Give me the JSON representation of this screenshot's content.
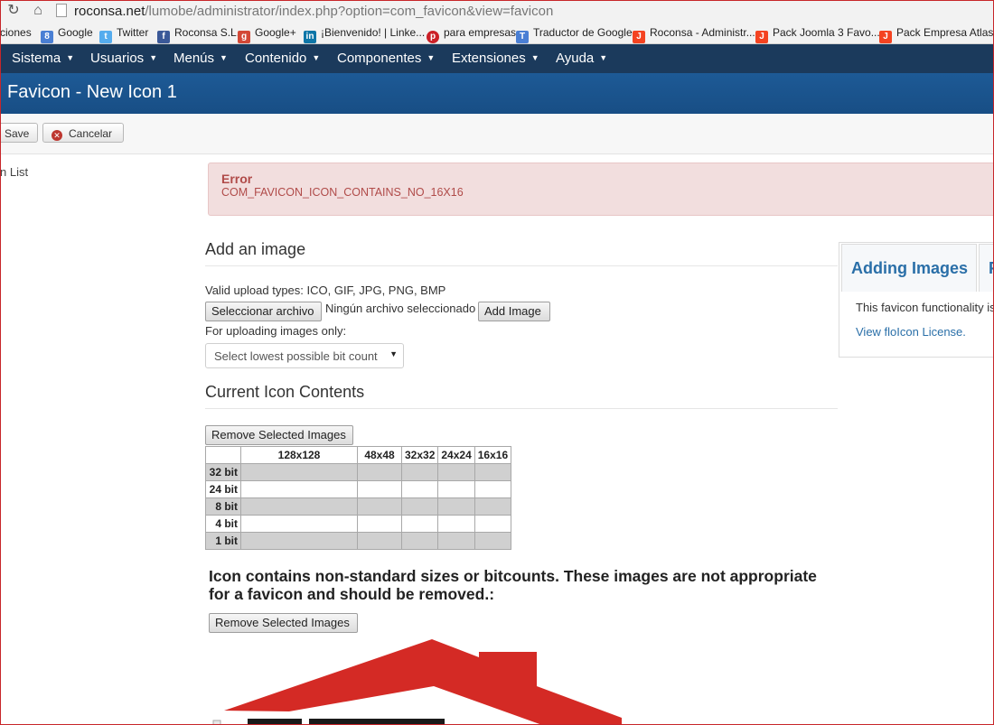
{
  "browser": {
    "url_host": "roconsa.net",
    "url_path": "/lumobe/administrator/index.php?option=com_favicon&view=favicon"
  },
  "bookmarks": [
    {
      "label": "ciones"
    },
    {
      "label": "Google"
    },
    {
      "label": "Twitter"
    },
    {
      "label": "Roconsa S.L."
    },
    {
      "label": "Google+"
    },
    {
      "label": "¡Bienvenido! | Linke..."
    },
    {
      "label": "para empresas"
    },
    {
      "label": "Traductor de Google"
    },
    {
      "label": "Roconsa - Administr..."
    },
    {
      "label": "Pack Joomla 3 Favo..."
    },
    {
      "label": "Pack Empresa Atlas ..."
    }
  ],
  "menu": [
    "Sistema",
    "Usuarios",
    "Menús",
    "Contenido",
    "Componentes",
    "Extensiones",
    "Ayuda"
  ],
  "header": {
    "title": "Favicon - New Icon 1"
  },
  "toolbar": {
    "save_label": "Save",
    "cancel_label": "Cancelar"
  },
  "sidebar": {
    "link": "n List"
  },
  "error": {
    "title": "Error",
    "message": "COM_FAVICON_ICON_CONTAINS_NO_16X16"
  },
  "add_image": {
    "heading": "Add an image",
    "upload_types": "Valid upload types: ICO, GIF, JPG, PNG, BMP",
    "choose_file_label": "Seleccionar archivo",
    "no_file_text": "Ningún archivo seleccionado",
    "add_button_label": "Add Image",
    "uploading_only": "For uploading images only:",
    "bit_select_value": "Select lowest possible bit count"
  },
  "current": {
    "heading": "Current Icon Contents",
    "remove_label": "Remove Selected Images",
    "columns": [
      "",
      "128x128",
      "48x48",
      "32x32",
      "24x24",
      "16x16"
    ],
    "rows": [
      "32 bit",
      "24 bit",
      "8 bit",
      "4 bit",
      "1 bit"
    ]
  },
  "warning": {
    "text": "Icon contains non-standard sizes or bitcounts. These images are not appropriate for a favicon and should be removed.:",
    "remove_label": "Remove Selected Images"
  },
  "help_panel": {
    "tab1": "Adding Images",
    "tab2": "F",
    "body": "This favicon functionality is",
    "link": "View floIcon License."
  },
  "colors": {
    "menu_bg": "#1b3a5c",
    "header_bg": "#1d5a96",
    "error_bg": "#f2dede",
    "error_text": "#b04b49",
    "link": "#2a6fa8",
    "logo_red": "#d42a25"
  }
}
